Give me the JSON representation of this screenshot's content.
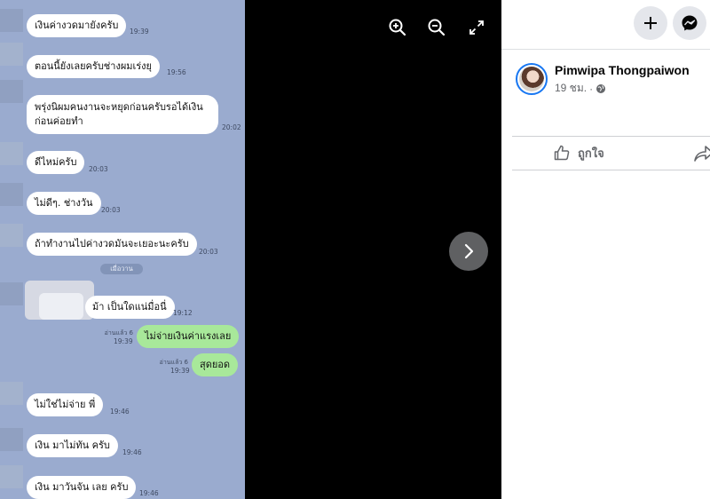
{
  "chat": {
    "messages": [
      {
        "text": "เงินค่างวดมายังครับ",
        "time": "19:39"
      },
      {
        "text": "ตอนนี้ยังเลยครับช่างผมเร่งยุ",
        "time": "19:56"
      },
      {
        "text": "พรุ่งนิผมคนงานจะหยุดก่อนครับรอได้เงินก่อนค่อยทำ",
        "time": "20:02"
      },
      {
        "text": "ดีไหม่ครับ",
        "time": "20:03"
      },
      {
        "text": "ไม่ดีๆ. ช่างวัน",
        "time": "20:03"
      },
      {
        "text": "ถ้าทำงานไปค่างวดมันจะเยอะนะครับ",
        "time": "20:03"
      },
      {
        "text": "ม้า เป็นใดแน่มื่อนี่",
        "time": "19:12"
      },
      {
        "text": "ไม่จ่ายเงินค่าแรงเลย",
        "time": "19:39",
        "read": "อ่านแล้ว 6"
      },
      {
        "text": "สุดยอด",
        "time": "19:39",
        "read": "อ่านแล้ว 6"
      },
      {
        "text": "ไม่ใช่ไม่จ่าย พี่",
        "time": "19:46"
      },
      {
        "text": "เงิน มาไม่ทัน ครับ",
        "time": "19:46"
      },
      {
        "text": "เงิน มาวันจัน เลย ครับ",
        "time": "19:46"
      }
    ],
    "date_divider": "เมื่อวาน"
  },
  "viewer": {
    "zoom_in_icon": "zoom-in-icon",
    "zoom_out_icon": "zoom-out-icon",
    "fullscreen_icon": "fullscreen-icon",
    "next_icon": "chevron-right-icon"
  },
  "panel": {
    "author": "Pimwipa Thongpaiwon",
    "time": "19 ชม.",
    "like_label": "ถูกใจ",
    "colors": {
      "accent": "#1877f2",
      "muted": "#65676b"
    }
  }
}
